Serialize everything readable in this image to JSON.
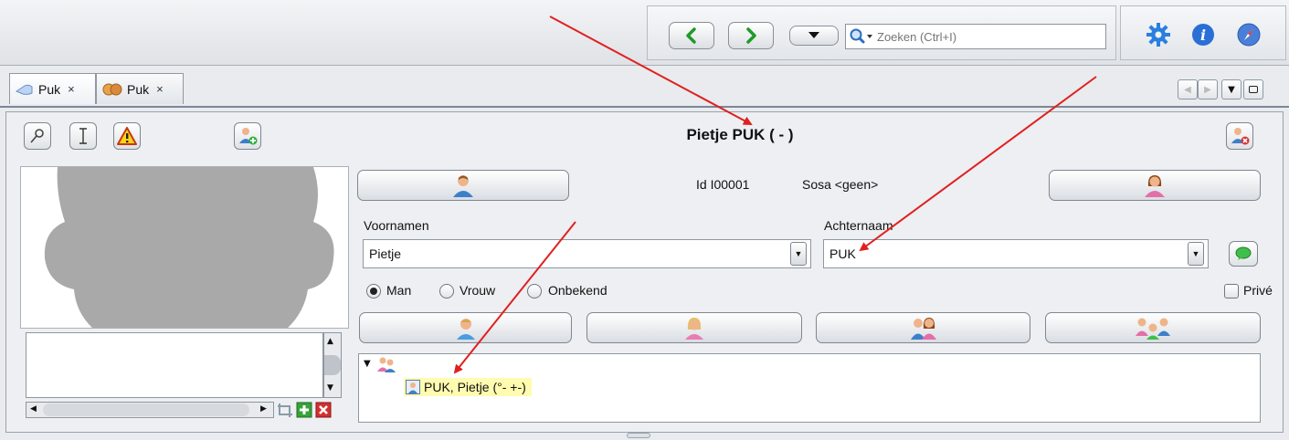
{
  "toolbar": {
    "search_placeholder": "Zoeken (Ctrl+I)"
  },
  "tabs": [
    {
      "label": "Puk",
      "icon": "pointing-hand-icon"
    },
    {
      "label": "Puk",
      "icon": "family-heads-icon"
    }
  ],
  "person": {
    "title": "Pietje PUK ( - )",
    "id_text": "Id I00001",
    "sosa_text": "Sosa <geen>"
  },
  "fields": {
    "firstnames_label": "Voornamen",
    "firstnames_value": "Pietje",
    "lastname_label": "Achternaam",
    "lastname_value": "PUK"
  },
  "gender": {
    "options": [
      "Man",
      "Vrouw",
      "Onbekend"
    ],
    "selected": "Man"
  },
  "privacy_label": "Privé",
  "tree": {
    "node_label": "PUK, Pietje (°- +-)"
  },
  "colors": {
    "accent_blue": "#2f6fcf",
    "annotation_red": "#e02020",
    "highlight": "#fffbb0"
  }
}
